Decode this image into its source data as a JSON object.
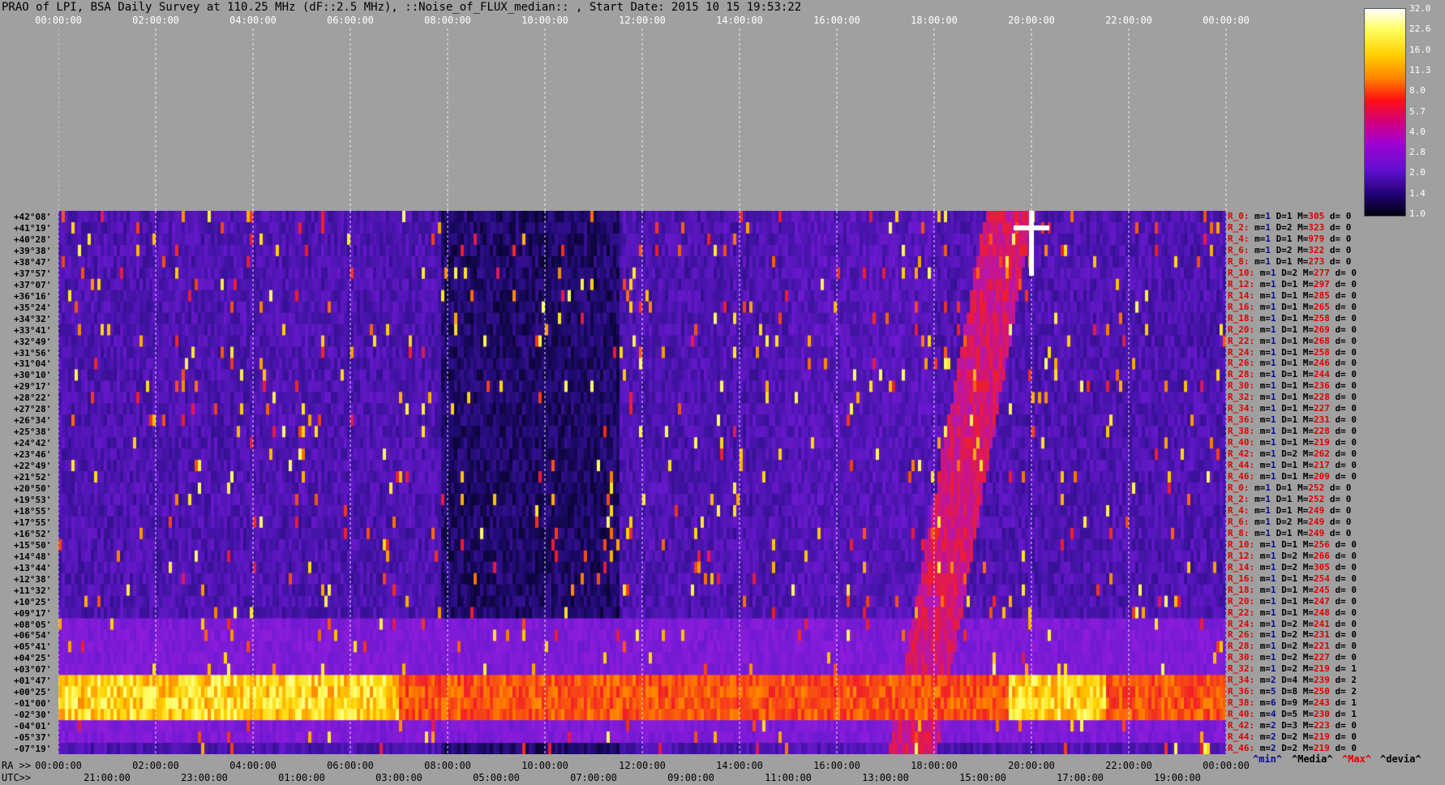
{
  "title": "PRAO of LPI, BSA Daily Survey at 110.25 MHz (dF::2.5 MHz), ::Noise_of_FLUX_median:: , Start Date: 2015 10 15 19:53:22",
  "chart_data": {
    "type": "heatmap",
    "top_axis_ticks": [
      "00:00:00",
      "02:00:00",
      "04:00:00",
      "06:00:00",
      "08:00:00",
      "10:00:00",
      "12:00:00",
      "14:00:00",
      "16:00:00",
      "18:00:00",
      "20:00:00",
      "22:00:00",
      "00:00:00"
    ],
    "ra_label": "RA >>",
    "ra_ticks": [
      "00:00:00",
      "02:00:00",
      "04:00:00",
      "06:00:00",
      "08:00:00",
      "10:00:00",
      "12:00:00",
      "14:00:00",
      "16:00:00",
      "18:00:00",
      "20:00:00",
      "22:00:00",
      "00:00:00"
    ],
    "utc_label": "UTC>>",
    "utc_ticks": [
      "21:00:00",
      "23:00:00",
      "01:00:00",
      "03:00:00",
      "05:00:00",
      "07:00:00",
      "09:00:00",
      "11:00:00",
      "13:00:00",
      "15:00:00",
      "17:00:00",
      "19:00:00"
    ],
    "declinations": [
      "+42°08'",
      "+41°19'",
      "+40°28'",
      "+39°38'",
      "+38°47'",
      "+37°57'",
      "+37°07'",
      "+36°16'",
      "+35°24'",
      "+34°32'",
      "+33°41'",
      "+32°49'",
      "+31°56'",
      "+31°04'",
      "+30°10'",
      "+29°17'",
      "+28°22'",
      "+27°28'",
      "+26°34'",
      "+25°38'",
      "+24°42'",
      "+23°46'",
      "+22°49'",
      "+21°52'",
      "+20°50'",
      "+19°53'",
      "+18°55'",
      "+17°55'",
      "+16°52'",
      "+15°50'",
      "+14°48'",
      "+13°44'",
      "+12°38'",
      "+11°32'",
      "+10°25'",
      "+09°17'",
      "+08°05'",
      "+06°54'",
      "+05°41'",
      "+04°25'",
      "+03°07'",
      "+01°47'",
      "+00°25'",
      "-01°00'",
      "-02°30'",
      "-04°01'",
      "-05°37'",
      "-07°19'"
    ],
    "row_stats": [
      [
        "R_0:",
        "1",
        "1",
        "305",
        "0"
      ],
      [
        "R_2:",
        "1",
        "2",
        "323",
        "0"
      ],
      [
        "R_4:",
        "1",
        "1",
        "979",
        "0"
      ],
      [
        "R_6:",
        "1",
        "2",
        "322",
        "0"
      ],
      [
        "R_8:",
        "1",
        "1",
        "273",
        "0"
      ],
      [
        "R_10:",
        "1",
        "2",
        "277",
        "0"
      ],
      [
        "R_12:",
        "1",
        "1",
        "297",
        "0"
      ],
      [
        "R_14:",
        "1",
        "1",
        "285",
        "0"
      ],
      [
        "R_16:",
        "1",
        "1",
        "265",
        "0"
      ],
      [
        "R_18:",
        "1",
        "1",
        "258",
        "0"
      ],
      [
        "R_20:",
        "1",
        "1",
        "269",
        "0"
      ],
      [
        "R_22:",
        "1",
        "1",
        "268",
        "0"
      ],
      [
        "R_24:",
        "1",
        "1",
        "258",
        "0"
      ],
      [
        "R_26:",
        "1",
        "1",
        "246",
        "0"
      ],
      [
        "R_28:",
        "1",
        "1",
        "244",
        "0"
      ],
      [
        "R_30:",
        "1",
        "1",
        "236",
        "0"
      ],
      [
        "R_32:",
        "1",
        "1",
        "228",
        "0"
      ],
      [
        "R_34:",
        "1",
        "1",
        "227",
        "0"
      ],
      [
        "R_36:",
        "1",
        "1",
        "231",
        "0"
      ],
      [
        "R_38:",
        "1",
        "1",
        "228",
        "0"
      ],
      [
        "R_40:",
        "1",
        "1",
        "219",
        "0"
      ],
      [
        "R_42:",
        "1",
        "2",
        "262",
        "0"
      ],
      [
        "R_44:",
        "1",
        "1",
        "217",
        "0"
      ],
      [
        "R_46:",
        "1",
        "1",
        "209",
        "0"
      ],
      [
        "R_0:",
        "1",
        "1",
        "252",
        "0"
      ],
      [
        "R_2:",
        "1",
        "1",
        "252",
        "0"
      ],
      [
        "R_4:",
        "1",
        "1",
        "249",
        "0"
      ],
      [
        "R_6:",
        "1",
        "2",
        "249",
        "0"
      ],
      [
        "R_8:",
        "1",
        "1",
        "249",
        "0"
      ],
      [
        "R_10:",
        "1",
        "1",
        "256",
        "0"
      ],
      [
        "R_12:",
        "1",
        "2",
        "266",
        "0"
      ],
      [
        "R_14:",
        "1",
        "2",
        "305",
        "0"
      ],
      [
        "R_16:",
        "1",
        "1",
        "254",
        "0"
      ],
      [
        "R_18:",
        "1",
        "1",
        "245",
        "0"
      ],
      [
        "R_20:",
        "1",
        "1",
        "247",
        "0"
      ],
      [
        "R_22:",
        "1",
        "1",
        "248",
        "0"
      ],
      [
        "R_24:",
        "1",
        "2",
        "241",
        "0"
      ],
      [
        "R_26:",
        "1",
        "2",
        "231",
        "0"
      ],
      [
        "R_28:",
        "1",
        "2",
        "221",
        "0"
      ],
      [
        "R_30:",
        "1",
        "2",
        "227",
        "0"
      ],
      [
        "R_32:",
        "1",
        "2",
        "219",
        "1"
      ],
      [
        "R_34:",
        "2",
        "4",
        "239",
        "2"
      ],
      [
        "R_36:",
        "5",
        "8",
        "250",
        "2"
      ],
      [
        "R_38:",
        "6",
        "9",
        "243",
        "1"
      ],
      [
        "R_40:",
        "4",
        "5",
        "230",
        "1"
      ],
      [
        "R_42:",
        "2",
        "3",
        "223",
        "0"
      ],
      [
        "R_44:",
        "2",
        "2",
        "219",
        "0"
      ],
      [
        "R_46:",
        "2",
        "2",
        "219",
        "0"
      ]
    ],
    "colorbar_ticks": [
      "32.0",
      "22.6",
      "16.0",
      "11.3",
      "8.0",
      "5.7",
      "4.0",
      "2.8",
      "2.0",
      "1.4",
      "1.0"
    ],
    "legend": [
      "^min^",
      "^Media^",
      "^Max^",
      "^devia^"
    ],
    "colors": {
      "background": "#a0a0a0",
      "low": "#000010",
      "mid": "#8a1ae0",
      "high": "#ff2000",
      "peak": "#ffffff"
    }
  }
}
